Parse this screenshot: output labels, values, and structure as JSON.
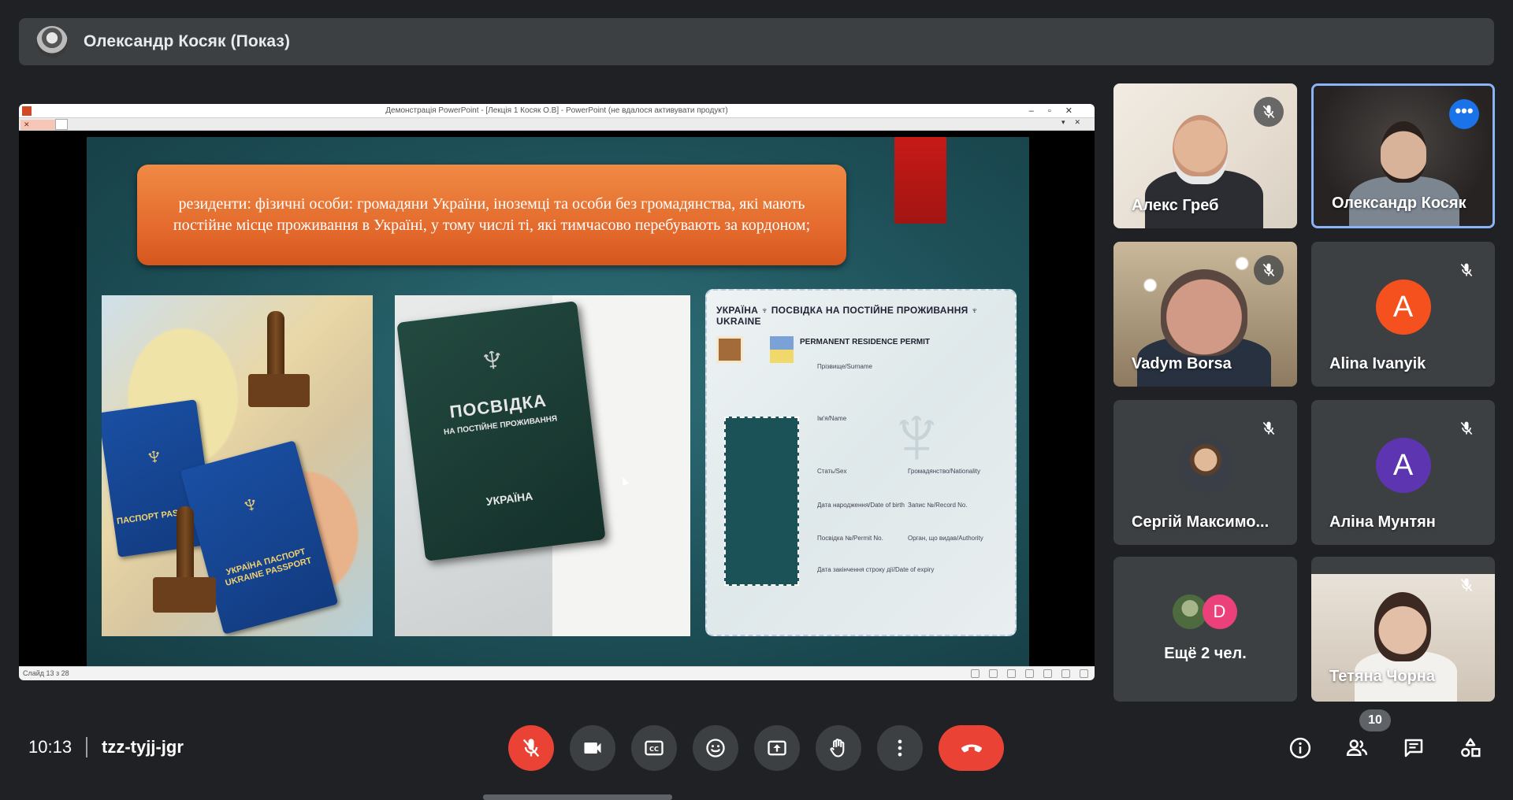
{
  "presenter": {
    "label": "Олександр Косяк (Показ)"
  },
  "shared_screen": {
    "window_title": "Демонстрація PowerPoint - [Лекція 1 Косяк О.В] - PowerPoint (не вдалося активувати продукт)",
    "status_text": "Слайд 13 з 28",
    "slide": {
      "heading_text": "резиденти: фізичні особи: громадяни України, іноземці та особи без громадянства, які мають постійне місце проживання в Україні, у тому числі ті, які тимчасово перебувають за кордоном;",
      "passport_text": "УКРАЇНА ПАСПОРТ UKRAINE PASSPORT",
      "passport_text_2": "ПАСПОРТ PASSPORT",
      "booklet_title": "ПОСВІДКА",
      "booklet_subtitle": "НА ПОСТІЙНЕ ПРОЖИВАННЯ",
      "booklet_country": "УКРАЇНА",
      "card_header": "УКРАЇНА ♆ ПОСВІДКА НА ПОСТІЙНЕ ПРОЖИВАННЯ ♆ UKRAINE",
      "card_subheader": "PERMANENT RESIDENCE PERMIT",
      "card_fields": {
        "surname": "Прізвище/Surname",
        "name": "Ім'я/Name",
        "sex": "Стать/Sex",
        "nationality": "Громадянство/Nationality",
        "dob": "Дата народження/Date of birth",
        "record": "Запис №/Record No.",
        "permit": "Посвідка №/Permit No.",
        "authority": "Орган, що видав/Authority",
        "expiry": "Дата закінчення строку дії/Date of expiry"
      }
    }
  },
  "participants": [
    {
      "name": "Алекс Греб",
      "muted": true,
      "type": "video"
    },
    {
      "name": "Олександр Косяк",
      "muted": false,
      "type": "video",
      "speaking": true
    },
    {
      "name": "Vadym Borsa",
      "muted": true,
      "type": "video"
    },
    {
      "name": "Alina Ivanyik",
      "muted": true,
      "type": "avatar",
      "initial": "A",
      "color": "#f4511e"
    },
    {
      "name": "Сергій Максимо...",
      "muted": true,
      "type": "photo"
    },
    {
      "name": "Аліна Мунтян",
      "muted": true,
      "type": "avatar",
      "initial": "A",
      "color": "#5e35b1"
    },
    {
      "name": "Тетяна Чорна",
      "muted": true,
      "type": "video"
    }
  ],
  "more_tile": {
    "label": "Ещё 2 чел.",
    "initial": "D",
    "initial_color": "#ec407a"
  },
  "bottom_bar": {
    "time": "10:13",
    "meeting_code": "tzz-tyjj-jgr",
    "participant_count": "10"
  },
  "colors": {
    "background": "#202124",
    "tile": "#3c4043",
    "danger": "#ea4335",
    "accent": "#8ab4f8"
  }
}
